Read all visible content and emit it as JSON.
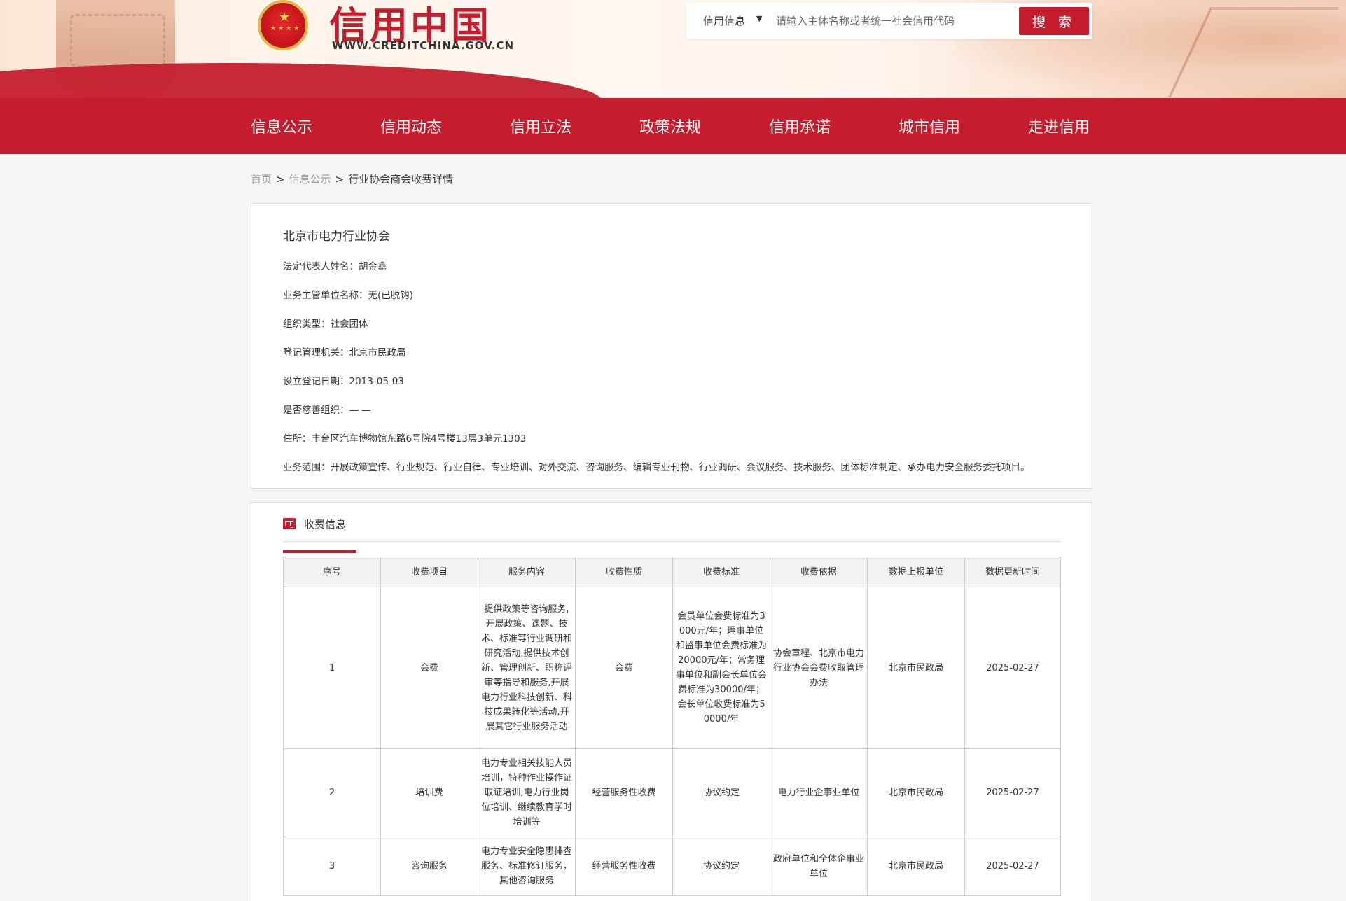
{
  "header": {
    "logo_title": "信用中国",
    "logo_url": "WWW.CREDITCHINA.GOV.CN",
    "search": {
      "category": "信用信息",
      "placeholder": "请输入主体名称或者统一社会信用代码",
      "button_label": "搜 索"
    }
  },
  "nav": {
    "items": [
      {
        "label": "信息公示"
      },
      {
        "label": "信用动态"
      },
      {
        "label": "信用立法"
      },
      {
        "label": "政策法规"
      },
      {
        "label": "信用承诺"
      },
      {
        "label": "城市信用"
      },
      {
        "label": "走进信用"
      }
    ]
  },
  "breadcrumb": {
    "home": "首页",
    "section": "信息公示",
    "current": "行业协会商会收费详情",
    "separator": ">"
  },
  "organization": {
    "name": "北京市电力行业协会",
    "fields": [
      {
        "label": "法定代表人姓名：",
        "value": "胡金鑫"
      },
      {
        "label": "业务主管单位名称：",
        "value": "无(已脱钩)"
      },
      {
        "label": "组织类型：",
        "value": "社会团体"
      },
      {
        "label": "登记管理机关：",
        "value": "北京市民政局"
      },
      {
        "label": "设立登记日期：",
        "value": "2013-05-03"
      },
      {
        "label": "是否慈善组织：",
        "value": "— —"
      },
      {
        "label": "住所：",
        "value": "丰台区汽车博物馆东路6号院4号楼13层3单元1303"
      },
      {
        "label": "业务范围：",
        "value": "开展政策宣传、行业规范、行业自律、专业培训、对外交流、咨询服务、编辑专业刊物、行业调研、会议服务、技术服务、团体标准制定、承办电力安全服务委托项目。"
      }
    ]
  },
  "fees": {
    "tab_label": "收费信息",
    "columns": [
      "序号",
      "收费项目",
      "服务内容",
      "收费性质",
      "收费标准",
      "收费依据",
      "数据上报单位",
      "数据更新时间"
    ],
    "rows": [
      [
        "1",
        "会费",
        "提供政策等咨询服务,开展政策、课题、技术、标准等行业调研和研究活动,提供技术创新、管理创新、职称评审等指导和服务,开展电力行业科技创新、科技成果转化等活动,开展其它行业服务活动",
        "会费",
        "会员单位会费标准为3000元/年；理事单位和监事单位会费标准为20000元/年；常务理事单位和副会长单位会费标准为30000/年；会长单位收费标准为50000/年",
        "协会章程、北京市电力行业协会会费收取管理办法",
        "北京市民政局",
        "2025-02-27"
      ],
      [
        "2",
        "培训费",
        "电力专业相关技能人员培训，特种作业操作证取证培训,电力行业岗位培训、继续教育学时培训等",
        "经营服务性收费",
        "协议约定",
        "电力行业企事业单位",
        "北京市民政局",
        "2025-02-27"
      ],
      [
        "3",
        "咨询服务",
        "电力专业安全隐患排查服务、标准修订服务，其他咨询服务",
        "经营服务性收费",
        "协议约定",
        "政府单位和全体企事业单位",
        "北京市民政局",
        "2025-02-27"
      ]
    ]
  }
}
